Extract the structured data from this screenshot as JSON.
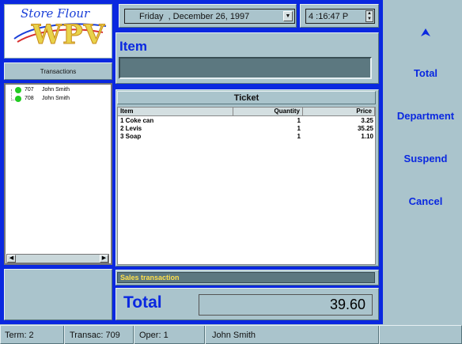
{
  "logo": {
    "top_text": "Store Flour",
    "main_text": "WPV"
  },
  "transactions": {
    "header": "Transactions",
    "items": [
      {
        "id": "707",
        "name": "John Smith"
      },
      {
        "id": "708",
        "name": "John Smith"
      }
    ]
  },
  "datetime": {
    "day": "Friday",
    "date": ", December 26, 1997",
    "time": "4 :16:47 P"
  },
  "item": {
    "title": "Item",
    "value": ""
  },
  "ticket": {
    "title": "Ticket",
    "columns": [
      "Item",
      "Quantity",
      "Price"
    ],
    "rows": [
      {
        "item": "1  Coke can",
        "qty": "1",
        "price": "3.25"
      },
      {
        "item": "2  Levis",
        "qty": "1",
        "price": "35.25"
      },
      {
        "item": "3  Soap",
        "qty": "1",
        "price": "1.10"
      }
    ]
  },
  "status_message": "Sales transaction",
  "total": {
    "label": "Total",
    "value": "39.60"
  },
  "actions": [
    "Total",
    "Department",
    "Suspend",
    "Cancel"
  ],
  "status_strip": {
    "term": "Term: 2",
    "transac": "Transac: 709",
    "oper": "Oper: 1",
    "user": "John Smith"
  },
  "colors": {
    "frame": "#0a28e0",
    "panel": "#aac4cc",
    "accent_text": "#0a28e0",
    "status_text": "#ffe04a"
  }
}
